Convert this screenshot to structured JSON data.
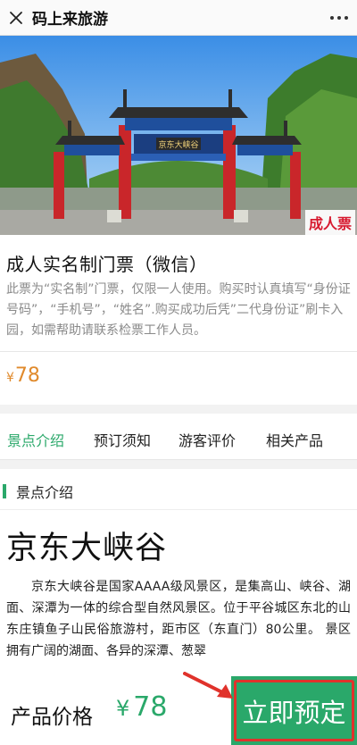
{
  "header": {
    "title": "码上来旅游",
    "close_icon": "close-icon",
    "more_icon": "more-icon"
  },
  "hero": {
    "badge": "成人票",
    "gate_plaque": "京东大峡谷"
  },
  "ticket": {
    "title": "成人实名制门票（微信）",
    "description": "此票为“实名制”门票，仅限一人使用。购买时认真填写“身份证号码”，“手机号”，“姓名”.购买成功后凭”二代身份证”刷卡入园，如需帮助请联系检票工作人员。",
    "currency": "¥",
    "price": "78"
  },
  "tabs": [
    {
      "label": "景点介绍",
      "active": true
    },
    {
      "label": "预订须知",
      "active": false
    },
    {
      "label": "游客评价",
      "active": false
    },
    {
      "label": "相关产品",
      "active": false
    }
  ],
  "section": {
    "label": "景点介绍",
    "scenic_name": "京东大峡谷",
    "description": "京东大峡谷是国家AAAA级风景区，是集高山、峡谷、湖面、深潭为一体的综合型自然风景区。位于平谷城区东北的山东庄镇鱼子山民俗旅游村，距市区（东直门）80公里。 景区拥有广阔的湖面、各异的深潭、葱翠"
  },
  "bottom": {
    "price_label": "产品价格",
    "currency": "¥",
    "price": "78",
    "book_label": "立即预定"
  },
  "colors": {
    "accent_green": "#2aa86a",
    "price_orange": "#e08a2c",
    "badge_red": "#d7192f",
    "highlight_red": "#e0322b"
  }
}
